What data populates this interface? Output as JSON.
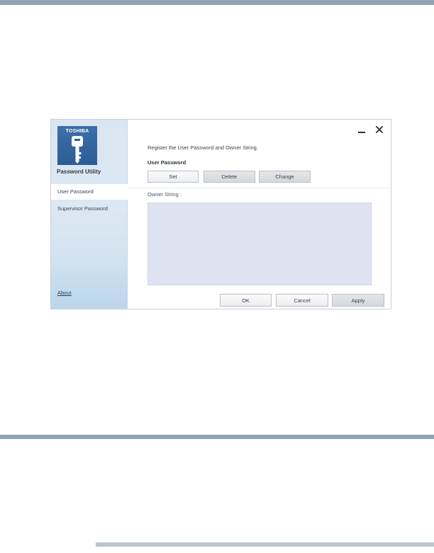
{
  "app": {
    "brand": "TOSHIBA",
    "title": "Password Utility"
  },
  "sidebar": {
    "items": [
      {
        "label": "User Password",
        "active": true
      },
      {
        "label": "Supervisor Password",
        "active": false
      }
    ],
    "about": "About"
  },
  "window_controls": {
    "minimize_icon": "minimize-icon",
    "close_icon": "close-icon"
  },
  "main": {
    "intro": "Register the User Password and Owner String.",
    "section_title": "User Password",
    "buttons": {
      "set": "Set",
      "delete": "Delete",
      "change": "Change"
    },
    "owner_label": "Owner String :",
    "owner_value": ""
  },
  "footer": {
    "ok": "OK",
    "cancel": "Cancel",
    "apply": "Apply"
  },
  "colors": {
    "page_rule": "#8fa3b3",
    "logo_tile": "#2b5d96",
    "owner_area": "#dfe2f1",
    "sidebar": "#d9e6f2"
  }
}
